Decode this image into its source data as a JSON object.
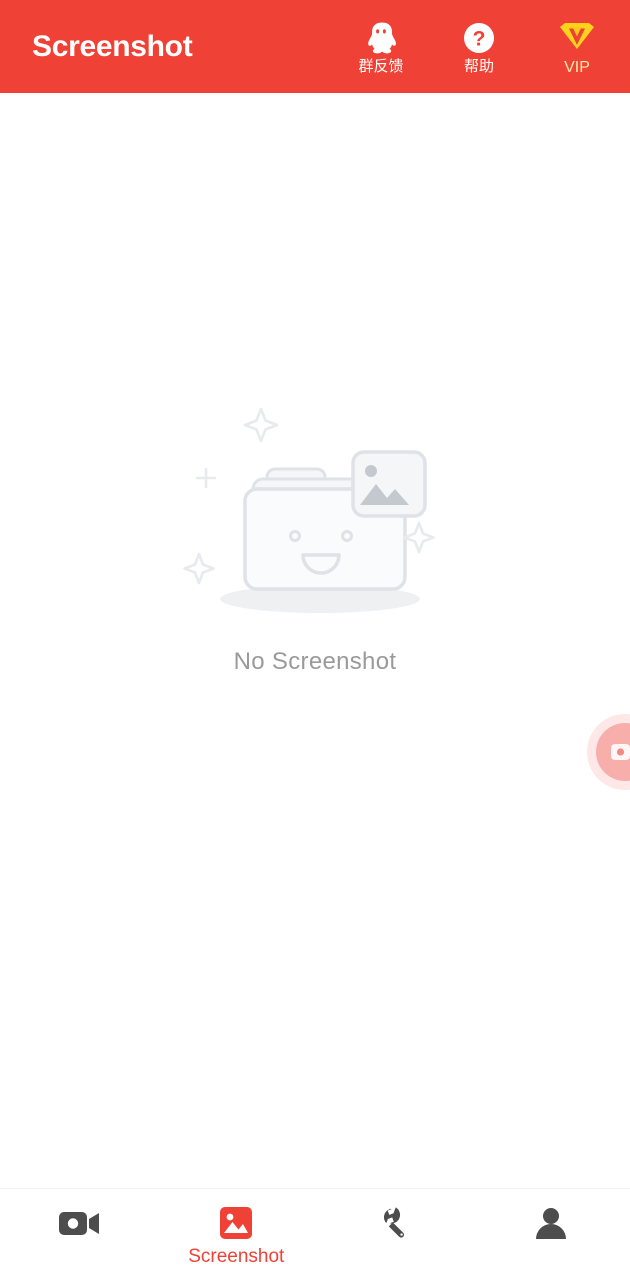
{
  "theme": {
    "brand_red": "#EF4136",
    "vip_gold": "#FFD21E",
    "empty_gray": "#9A9A9A",
    "illustration_gray": "#DFE2E6",
    "nav_inactive": "#4D4D4D",
    "background": "#FFFFFF"
  },
  "header": {
    "title": "Screenshot",
    "actions": [
      {
        "icon": "qq-penguin-icon",
        "label": "群反馈"
      },
      {
        "icon": "help-question-icon",
        "label": "帮助"
      },
      {
        "icon": "vip-diamond-icon",
        "label": "VIP"
      }
    ]
  },
  "main": {
    "empty_state": {
      "illustration": "empty-folder-image-icon",
      "message": "No Screenshot"
    }
  },
  "floating_widget": {
    "icon": "record-camcorder-icon",
    "label": ""
  },
  "tabbar": {
    "tabs": [
      {
        "icon": "video-camera-icon",
        "label": "",
        "active": false
      },
      {
        "icon": "screenshot-image-icon",
        "label": "Screenshot",
        "active": true
      },
      {
        "icon": "wrench-tools-icon",
        "label": "",
        "active": false
      },
      {
        "icon": "person-profile-icon",
        "label": "",
        "active": false
      }
    ]
  }
}
